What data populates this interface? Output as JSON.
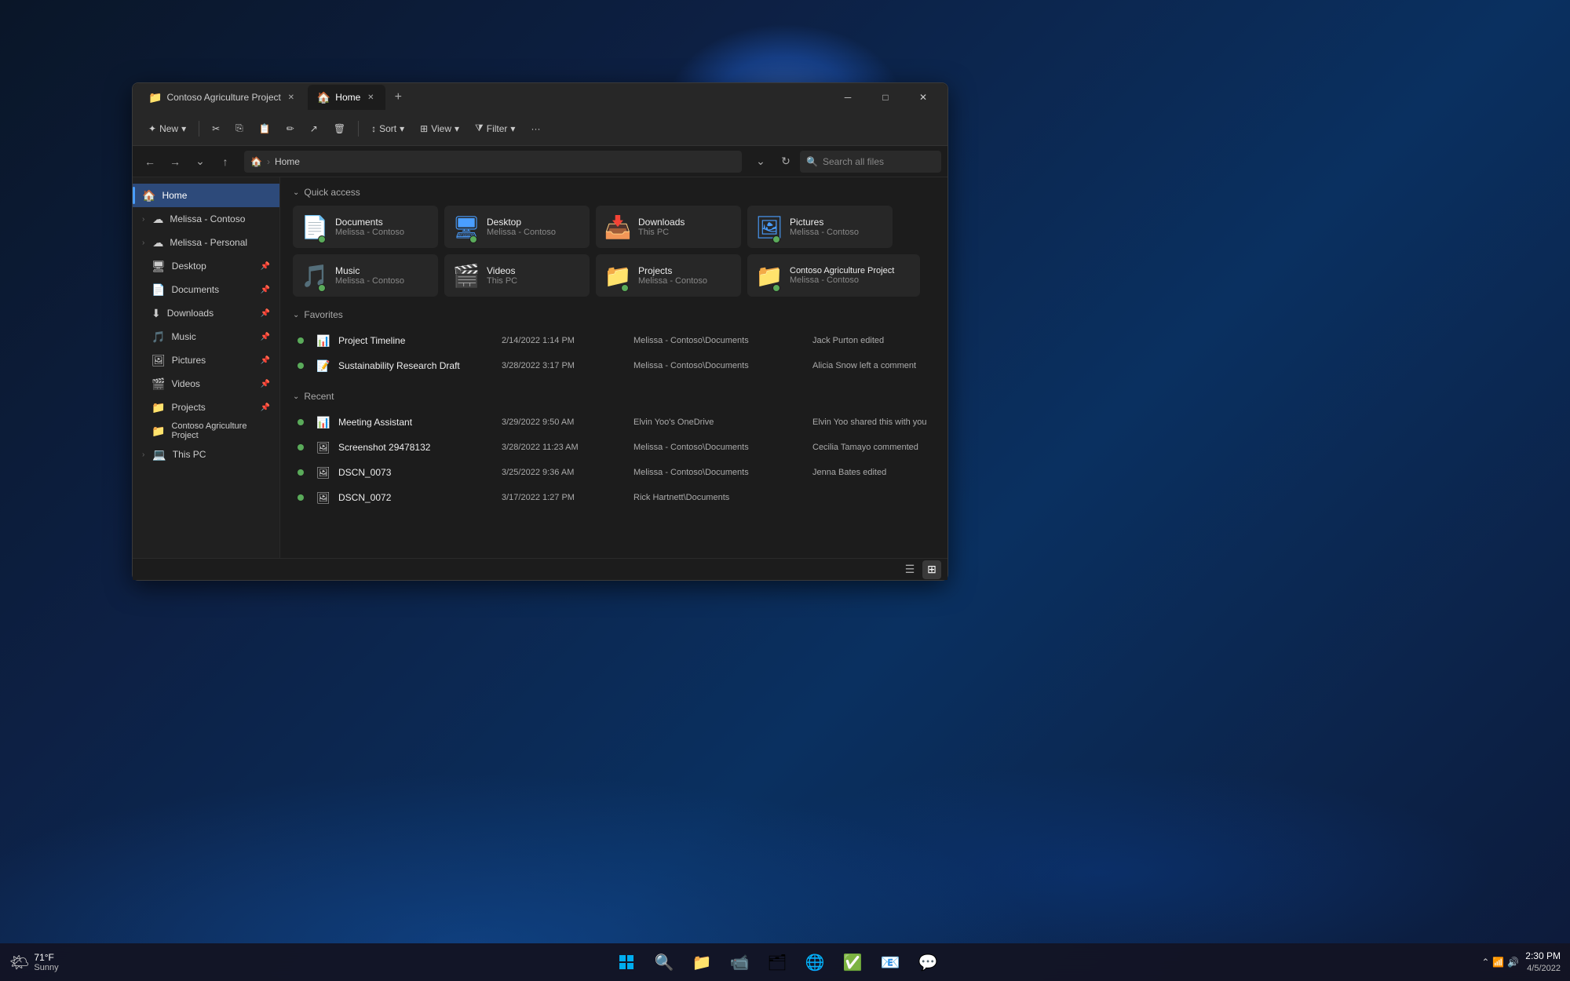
{
  "window": {
    "tabs": [
      {
        "label": "Contoso Agriculture Project",
        "active": false,
        "icon": "📁"
      },
      {
        "label": "Home",
        "active": true,
        "icon": "🏠"
      }
    ],
    "controls": {
      "minimize": "─",
      "maximize": "□",
      "close": "✕"
    }
  },
  "toolbar": {
    "new_label": "New",
    "cut_label": "✂",
    "copy_label": "⎘",
    "paste_label": "📋",
    "rename_label": "✏",
    "share_label": "↗",
    "delete_label": "🗑",
    "sort_label": "Sort",
    "view_label": "View",
    "filter_label": "Filter",
    "more_label": "···"
  },
  "navigation": {
    "back": "←",
    "forward": "→",
    "recent": "∨",
    "up": "↑",
    "home_icon": "🏠",
    "breadcrumb": [
      "Home"
    ],
    "search_placeholder": "Search all files",
    "refresh": "↻"
  },
  "sidebar": {
    "home": {
      "label": "Home",
      "active": true,
      "icon": "🏠"
    },
    "cloud_items": [
      {
        "label": "Melissa - Contoso",
        "icon": "☁",
        "expanded": false
      },
      {
        "label": "Melissa - Personal",
        "icon": "☁",
        "expanded": false
      }
    ],
    "pinned": [
      {
        "label": "Desktop",
        "icon": "🖥",
        "pinned": true
      },
      {
        "label": "Documents",
        "icon": "📄",
        "pinned": true
      },
      {
        "label": "Downloads",
        "icon": "⬇",
        "pinned": true
      },
      {
        "label": "Music",
        "icon": "🎵",
        "pinned": true
      },
      {
        "label": "Pictures",
        "icon": "🖼",
        "pinned": true
      },
      {
        "label": "Videos",
        "icon": "🎬",
        "pinned": true
      },
      {
        "label": "Projects",
        "icon": "📁",
        "pinned": true
      },
      {
        "label": "Contoso Agriculture Project",
        "icon": "📁",
        "pinned": false
      }
    ],
    "this_pc": {
      "label": "This PC",
      "icon": "💻",
      "expanded": false
    }
  },
  "quick_access": {
    "title": "Quick access",
    "folders": [
      {
        "name": "Documents",
        "sub": "Melissa - Contoso",
        "icon": "📄",
        "color": "teal",
        "synced": true
      },
      {
        "name": "Desktop",
        "sub": "Melissa - Contoso",
        "icon": "🖥",
        "color": "blue",
        "synced": true
      },
      {
        "name": "Downloads",
        "sub": "This PC",
        "icon": "⬇",
        "color": "blue",
        "synced": false
      },
      {
        "name": "Pictures",
        "sub": "Melissa - Contoso",
        "icon": "🖼",
        "color": "blue",
        "synced": true
      },
      {
        "name": "Music",
        "sub": "Melissa - Contoso",
        "icon": "🎵",
        "color": "orange",
        "synced": true
      },
      {
        "name": "Videos",
        "sub": "This PC",
        "icon": "🎬",
        "color": "purple",
        "synced": false
      },
      {
        "name": "Projects",
        "sub": "Melissa - Contoso",
        "icon": "📁",
        "color": "yellow",
        "synced": true
      },
      {
        "name": "Contoso Agriculture Project",
        "sub": "Melissa - Contoso",
        "icon": "📁",
        "color": "yellow",
        "synced": true
      }
    ]
  },
  "favorites": {
    "title": "Favorites",
    "files": [
      {
        "name": "Project Timeline",
        "date": "2/14/2022 1:14 PM",
        "location": "Melissa - Contoso\\Documents",
        "activity": "Jack Purton edited",
        "type": "📊",
        "synced": true
      },
      {
        "name": "Sustainability Research Draft",
        "date": "3/28/2022 3:17 PM",
        "location": "Melissa - Contoso\\Documents",
        "activity": "Alicia Snow left a comment",
        "type": "📝",
        "synced": true
      }
    ]
  },
  "recent": {
    "title": "Recent",
    "files": [
      {
        "name": "Meeting Assistant",
        "date": "3/29/2022 9:50 AM",
        "location": "Elvin Yoo's OneDrive",
        "activity": "Elvin Yoo shared this with you",
        "type": "📊",
        "synced": true
      },
      {
        "name": "Screenshot 29478132",
        "date": "3/28/2022 11:23 AM",
        "location": "Melissa - Contoso\\Documents",
        "activity": "Cecilia Tamayo commented",
        "type": "🖼",
        "synced": true
      },
      {
        "name": "DSCN_0073",
        "date": "3/25/2022 9:36 AM",
        "location": "Melissa - Contoso\\Documents",
        "activity": "Jenna Bates edited",
        "type": "🖼",
        "synced": true
      },
      {
        "name": "DSCN_0072",
        "date": "3/17/2022 1:27 PM",
        "location": "Rick Hartnett\\Documents",
        "activity": "",
        "type": "🖼",
        "synced": true
      }
    ]
  },
  "taskbar": {
    "weather": {
      "temp": "71°F",
      "condition": "Sunny",
      "icon": "🌤"
    },
    "center_icons": [
      {
        "name": "start",
        "icon": "⊞",
        "label": "Start"
      },
      {
        "name": "search",
        "icon": "🔍",
        "label": "Search"
      },
      {
        "name": "file-explorer",
        "icon": "📁",
        "label": "File Explorer"
      },
      {
        "name": "teams",
        "icon": "📹",
        "label": "Teams"
      },
      {
        "name": "explorer2",
        "icon": "🗂",
        "label": "Files"
      },
      {
        "name": "edge",
        "icon": "🌐",
        "label": "Edge"
      },
      {
        "name": "todo",
        "icon": "✅",
        "label": "To Do"
      },
      {
        "name": "outlook",
        "icon": "📧",
        "label": "Outlook"
      },
      {
        "name": "teams2",
        "icon": "💬",
        "label": "Teams Chat"
      }
    ],
    "clock": {
      "time": "2:30 PM",
      "date": "4/5/2022"
    }
  }
}
